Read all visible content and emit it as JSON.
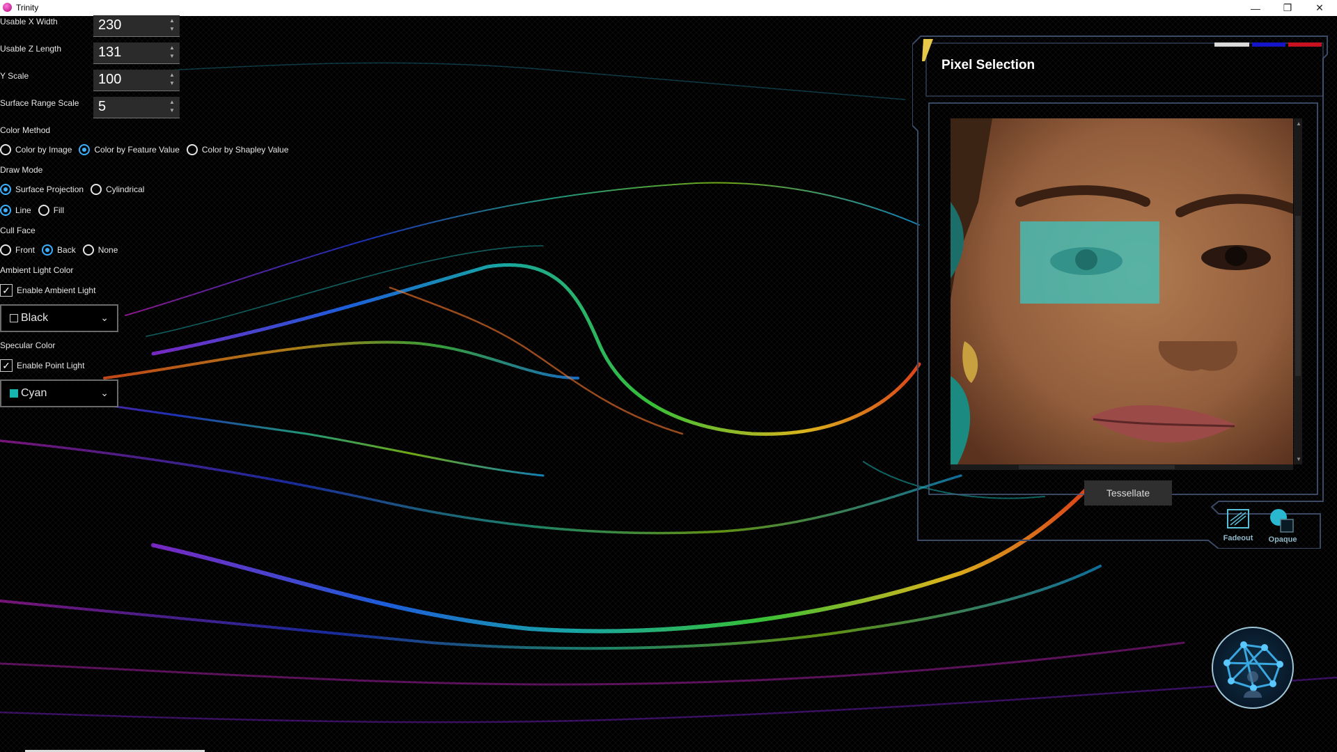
{
  "window": {
    "title": "Trinity",
    "controls": [
      "minimize-icon",
      "restore-icon",
      "close-icon"
    ]
  },
  "fields": {
    "usable_x_width": {
      "label": "Usable X Width",
      "value": "230"
    },
    "usable_z_length": {
      "label": "Usable Z Length",
      "value": "131"
    },
    "y_scale": {
      "label": "Y Scale",
      "value": "100"
    },
    "surface_range_scale": {
      "label": "Surface Range Scale",
      "value": "5"
    }
  },
  "color_method": {
    "label": "Color Method",
    "options": [
      "Color by Image",
      "Color by Feature Value",
      "Color by Shapley Value"
    ],
    "selected": "Color by Feature Value"
  },
  "draw_mode": {
    "label": "Draw Mode",
    "projection_options": [
      "Surface Projection",
      "Cylindrical"
    ],
    "projection_selected": "Surface Projection",
    "style_options": [
      "Line",
      "Fill"
    ],
    "style_selected": "Line"
  },
  "cull_face": {
    "label": "Cull Face",
    "options": [
      "Front",
      "Back",
      "None"
    ],
    "selected": "Back"
  },
  "ambient": {
    "label": "Ambient Light Color",
    "checkbox_label": "Enable Ambient Light",
    "checked": true,
    "color": "Black",
    "swatch": "#000000"
  },
  "specular": {
    "label": "Specular Color",
    "checkbox_label": "Enable Point Light",
    "checked": true,
    "color": "Cyan",
    "swatch": "#17b5b0"
  },
  "pixel_selection": {
    "title": "Pixel Selection",
    "tessellate_label": "Tessellate",
    "tools": [
      {
        "label": "Fadeout",
        "icon": "fadeout-icon"
      },
      {
        "label": "Opaque",
        "icon": "opaque-icon"
      }
    ],
    "header_colors": [
      "#d9d9d9",
      "#1515c8",
      "#c8121f"
    ],
    "selection_color": "#3cc6c0"
  },
  "network_button": {
    "icon": "neural-network-icon"
  }
}
